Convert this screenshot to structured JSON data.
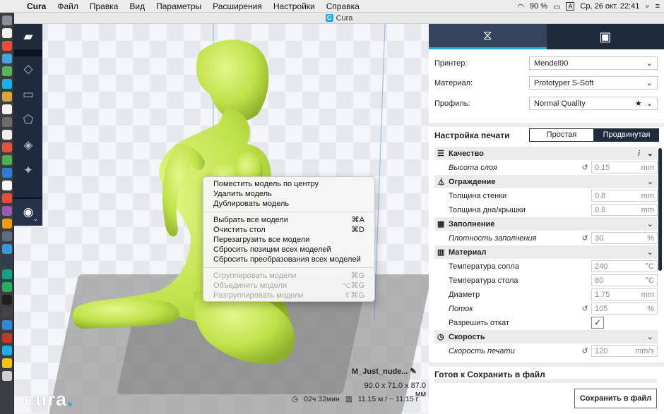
{
  "menubar": {
    "apple": "",
    "app": "Cura",
    "items": [
      "Файл",
      "Правка",
      "Вид",
      "Параметры",
      "Расширения",
      "Настройки",
      "Справка"
    ],
    "battery": "90 %",
    "input_lang": "A",
    "clock": "Ср, 26 окт. 22:41"
  },
  "window": {
    "title": "Cura"
  },
  "toolbar": {
    "icons": [
      "folder-open-icon",
      "move-icon",
      "scale-icon",
      "rotate-icon",
      "mirror-icon",
      "per-model-settings-icon",
      "view-mode-icon"
    ]
  },
  "context_menu": {
    "group1": [
      {
        "label": "Поместить модель по центру",
        "shortcut": ""
      },
      {
        "label": "Удалить модель",
        "shortcut": ""
      },
      {
        "label": "Дублировать модель",
        "shortcut": ""
      }
    ],
    "group2": [
      {
        "label": "Выбрать все модели",
        "shortcut": "⌘A"
      },
      {
        "label": "Очистить стол",
        "shortcut": "⌘D"
      },
      {
        "label": "Перезагрузить все модели",
        "shortcut": ""
      },
      {
        "label": "Сбросить позиции всех моделей",
        "shortcut": ""
      },
      {
        "label": "Сбросить преобразования всех моделей",
        "shortcut": ""
      }
    ],
    "group3": [
      {
        "label": "Сгруппировать модели",
        "shortcut": "⌘G"
      },
      {
        "label": "Объединить модели",
        "shortcut": "⌥⌘G"
      },
      {
        "label": "Разгруппировать модели",
        "shortcut": "⇧⌘G"
      }
    ]
  },
  "viewport": {
    "logo": "cura",
    "logo_dot": ".",
    "model_name": "M_Just_nude...",
    "dimensions": "90.0 x 71.0 x 87.0 мм",
    "print_time": "02ч 32мин",
    "material_usage": "11.15 м / ~ 11.15 г"
  },
  "panel": {
    "printer_label": "Принтер:",
    "printer_value": "Mendel90",
    "material_label": "Материал:",
    "material_value": "Prototyper S-Soft",
    "profile_label": "Профиль:",
    "profile_value": "Normal Quality",
    "print_setup_title": "Настройка печати",
    "mode_simple": "Простая",
    "mode_advanced": "Продвинутая",
    "categories": {
      "quality": "Качество",
      "shell": "Ограждение",
      "infill": "Заполнение",
      "material": "Материал",
      "speed": "Скорость"
    },
    "settings": {
      "layer_height": {
        "label": "Высота слоя",
        "value": "0.15",
        "unit": "mm"
      },
      "wall_thickness": {
        "label": "Толщина стенки",
        "value": "0.8",
        "unit": "mm"
      },
      "top_bottom": {
        "label": "Толщина дна/крышки",
        "value": "0.8",
        "unit": "mm"
      },
      "infill_density": {
        "label": "Плотность заполнения",
        "value": "30",
        "unit": "%"
      },
      "nozzle_temp": {
        "label": "Температура сопла",
        "value": "240",
        "unit": "°C"
      },
      "bed_temp": {
        "label": "Температура стола",
        "value": "80",
        "unit": "°C"
      },
      "diameter": {
        "label": "Диаметр",
        "value": "1.75",
        "unit": "mm"
      },
      "flow": {
        "label": "Поток",
        "value": "105",
        "unit": "%"
      },
      "retraction": {
        "label": "Разрешить откат",
        "checked": "✓"
      },
      "print_speed": {
        "label": "Скорость печати",
        "value": "120",
        "unit": "mm/s"
      }
    },
    "save_header": "Готов к Сохранить в файл",
    "save_button": "Сохранить в файл"
  },
  "colors": {
    "dark_navy": "#1f2a3d",
    "accent": "#1eaee6",
    "model": "#c8ec52"
  }
}
